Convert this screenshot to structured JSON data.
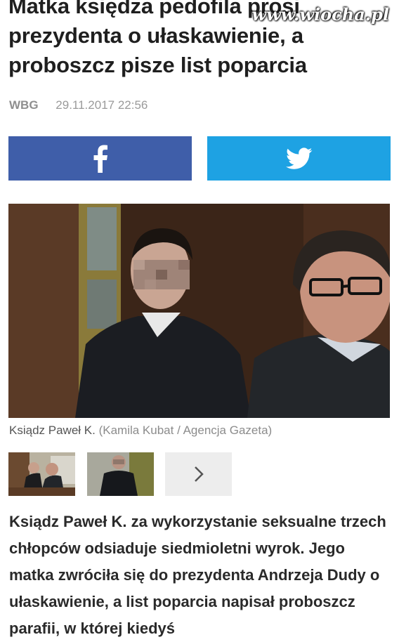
{
  "watermark": "www.wiocha.pl",
  "article": {
    "headline": "Matka księdza pedofila prosi prezydenta o ułaskawienie, a proboszcz pisze list poparcia",
    "author": "WBG",
    "datetime": "29.11.2017 22:56",
    "lead": "Ksiądz Paweł K. za wykorzystanie seksualne trzech chłopców odsiaduje siedmioletni wyrok. Jego matka zwróciła się do prezydenta Andrzeja Dudy o ułaskawienie, a list poparcia napisał proboszcz parafii, w której kiedyś"
  },
  "share": {
    "facebook_icon": "facebook-icon",
    "twitter_icon": "twitter-icon",
    "facebook_color": "#3f5ea9",
    "twitter_color": "#1ea2e3"
  },
  "photo": {
    "caption": "Ksiądz Paweł K.",
    "credit": "(Kamila Kubat / Agencja Gazeta)"
  },
  "gallery": {
    "next_icon": "chevron-right-icon"
  }
}
